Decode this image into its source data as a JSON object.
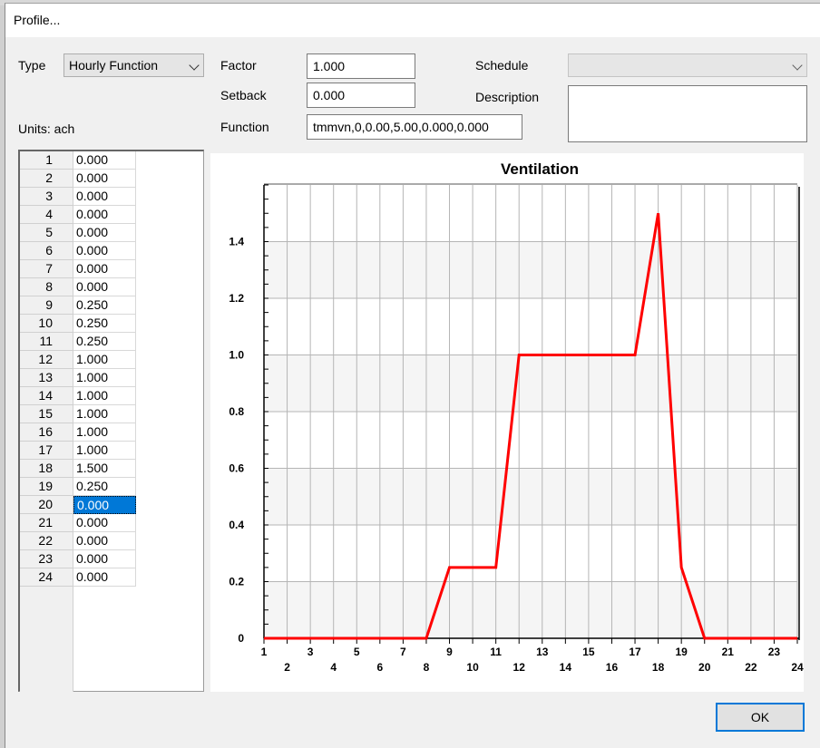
{
  "dialog": {
    "title": "Profile..."
  },
  "type": {
    "label": "Type",
    "value": "Hourly Function"
  },
  "factor": {
    "label": "Factor",
    "value": "1.000"
  },
  "setback": {
    "label": "Setback",
    "value": "0.000"
  },
  "function": {
    "label": "Function",
    "value": "tmmvn,0,0.00,5.00,0.000,0.000"
  },
  "schedule": {
    "label": "Schedule",
    "value": ""
  },
  "description": {
    "label": "Description",
    "value": ""
  },
  "units": {
    "label": "Units: ach"
  },
  "grid": {
    "selected_row": 20,
    "rows": [
      {
        "hour": "1",
        "value": "0.000"
      },
      {
        "hour": "2",
        "value": "0.000"
      },
      {
        "hour": "3",
        "value": "0.000"
      },
      {
        "hour": "4",
        "value": "0.000"
      },
      {
        "hour": "5",
        "value": "0.000"
      },
      {
        "hour": "6",
        "value": "0.000"
      },
      {
        "hour": "7",
        "value": "0.000"
      },
      {
        "hour": "8",
        "value": "0.000"
      },
      {
        "hour": "9",
        "value": "0.250"
      },
      {
        "hour": "10",
        "value": "0.250"
      },
      {
        "hour": "11",
        "value": "0.250"
      },
      {
        "hour": "12",
        "value": "1.000"
      },
      {
        "hour": "13",
        "value": "1.000"
      },
      {
        "hour": "14",
        "value": "1.000"
      },
      {
        "hour": "15",
        "value": "1.000"
      },
      {
        "hour": "16",
        "value": "1.000"
      },
      {
        "hour": "17",
        "value": "1.000"
      },
      {
        "hour": "18",
        "value": "1.500"
      },
      {
        "hour": "19",
        "value": "0.250"
      },
      {
        "hour": "20",
        "value": "0.000"
      },
      {
        "hour": "21",
        "value": "0.000"
      },
      {
        "hour": "22",
        "value": "0.000"
      },
      {
        "hour": "23",
        "value": "0.000"
      },
      {
        "hour": "24",
        "value": "0.000"
      }
    ]
  },
  "chart_data": {
    "type": "line",
    "title": "Ventilation",
    "x": [
      1,
      2,
      3,
      4,
      5,
      6,
      7,
      8,
      9,
      10,
      11,
      12,
      13,
      14,
      15,
      16,
      17,
      18,
      19,
      20,
      21,
      22,
      23,
      24
    ],
    "series": [
      {
        "values": [
          0,
          0,
          0,
          0,
          0,
          0,
          0,
          0,
          0.25,
          0.25,
          0.25,
          1,
          1,
          1,
          1,
          1,
          1,
          1.5,
          0.25,
          0,
          0,
          0,
          0,
          0
        ],
        "color": "#ff0000"
      }
    ],
    "xlim": [
      1,
      24
    ],
    "ylim": [
      0,
      1.6
    ],
    "yticks": [
      0,
      0.2,
      0.4,
      0.6,
      0.8,
      1.0,
      1.2,
      1.4
    ],
    "ytick_labels": [
      "0",
      "0.2",
      "0.4",
      "0.6",
      "0.8",
      "1.0",
      "1.2",
      "1.4"
    ],
    "xtick_labels": [
      "1",
      "2",
      "3",
      "4",
      "5",
      "6",
      "7",
      "8",
      "9",
      "10",
      "11",
      "12",
      "13",
      "14",
      "15",
      "16",
      "17",
      "18",
      "19",
      "20",
      "21",
      "22",
      "23",
      "24"
    ],
    "grid": true,
    "xlabel": "",
    "ylabel": ""
  },
  "buttons": {
    "ok": "OK"
  }
}
